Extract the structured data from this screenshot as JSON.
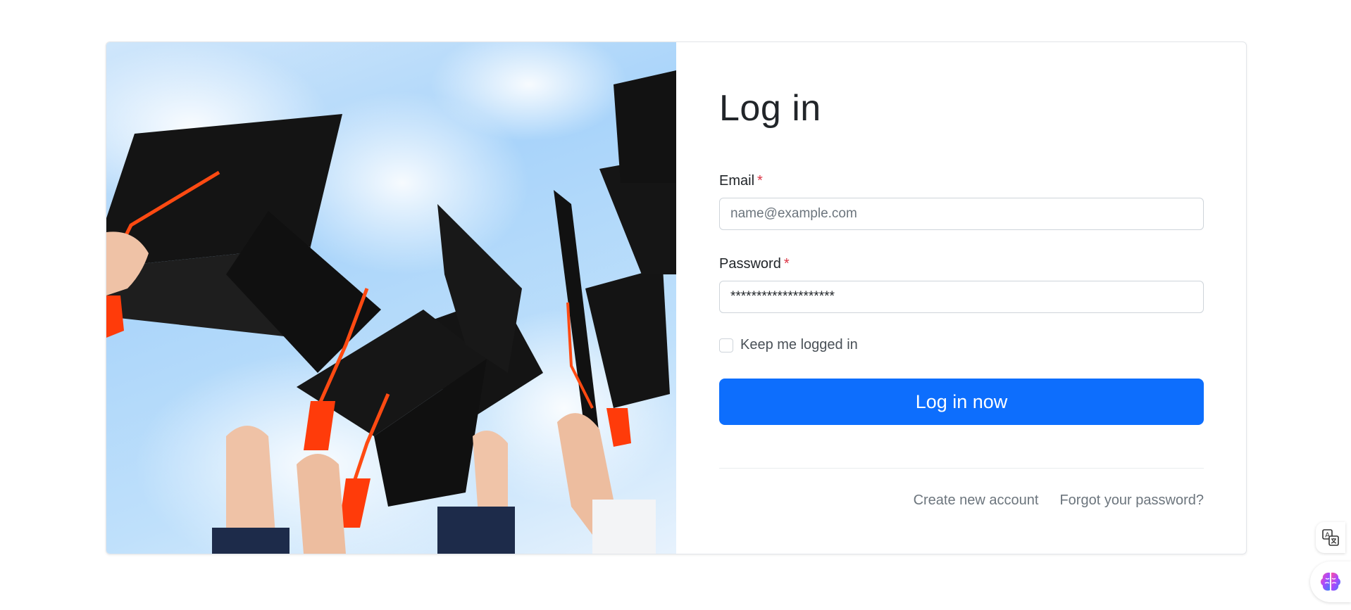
{
  "login": {
    "title": "Log in",
    "email_label": "Email",
    "email_required_mark": "*",
    "email_placeholder": "name@example.com",
    "password_label": "Password",
    "password_required_mark": "*",
    "password_value": "********************",
    "keep_logged_in_label": "Keep me logged in",
    "keep_logged_in_checked": false,
    "submit_label": "Log in now",
    "create_account_link": "Create new account",
    "forgot_password_link": "Forgot your password?"
  },
  "hero_image": {
    "subject": "graduation-caps-thrown-in-air",
    "alt": ""
  },
  "floating_buttons": {
    "translate_icon": "translate-icon",
    "assistant_icon": "brain-icon"
  },
  "colors": {
    "primary": "#0d6efd",
    "required": "#dc3545",
    "muted_text": "#6c757d",
    "border": "#ced4da"
  }
}
